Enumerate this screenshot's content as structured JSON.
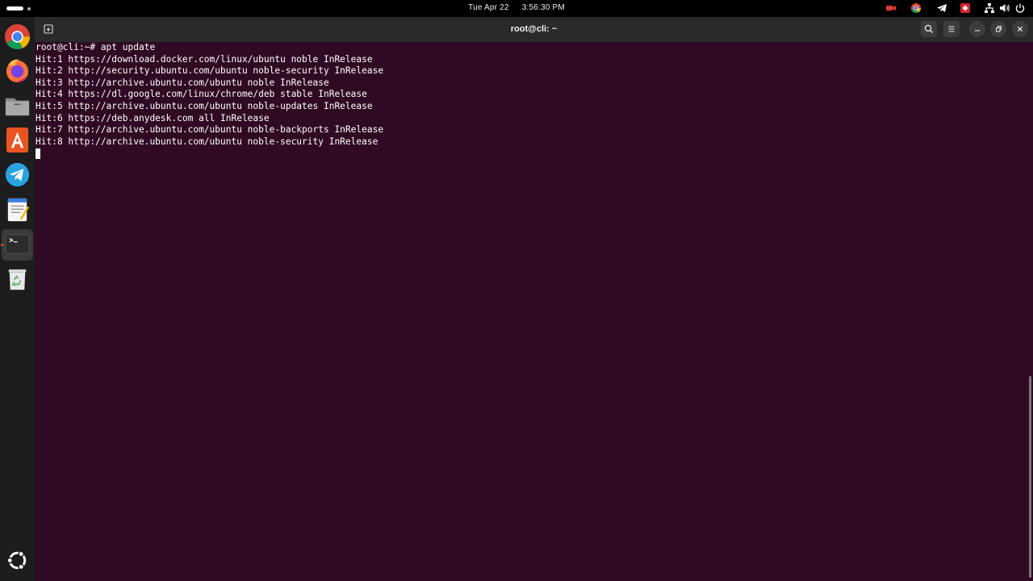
{
  "topbar": {
    "date": "Tue Apr 22",
    "time": "3:56:30 PM",
    "tray_icons": [
      "screen-record-icon",
      "chrome-icon",
      "telegram-icon",
      "anydesk-icon",
      "network-icon",
      "volume-icon",
      "power-icon"
    ]
  },
  "dock": {
    "apps": [
      "chrome-icon",
      "firefox-icon",
      "files-icon",
      "app-center-icon",
      "telegram-icon",
      "text-editor-icon",
      "terminal-icon",
      "trash-icon"
    ],
    "show_apps": "ubuntu-logo-icon",
    "active_app": "terminal-icon"
  },
  "window": {
    "title": "root@cli: ~"
  },
  "terminal": {
    "lines": [
      "root@cli:~# apt update",
      "Hit:1 https://download.docker.com/linux/ubuntu noble InRelease",
      "Hit:2 http://security.ubuntu.com/ubuntu noble-security InRelease",
      "Hit:3 http://archive.ubuntu.com/ubuntu noble InRelease",
      "Hit:4 https://dl.google.com/linux/chrome/deb stable InRelease",
      "Hit:5 http://archive.ubuntu.com/ubuntu noble-updates InRelease",
      "Hit:6 https://deb.anydesk.com all InRelease",
      "Hit:7 http://archive.ubuntu.com/ubuntu noble-backports InRelease",
      "Hit:8 http://archive.ubuntu.com/ubuntu noble-security InRelease"
    ],
    "colors": {
      "background": "#300a24",
      "foreground": "#ffffff"
    }
  }
}
